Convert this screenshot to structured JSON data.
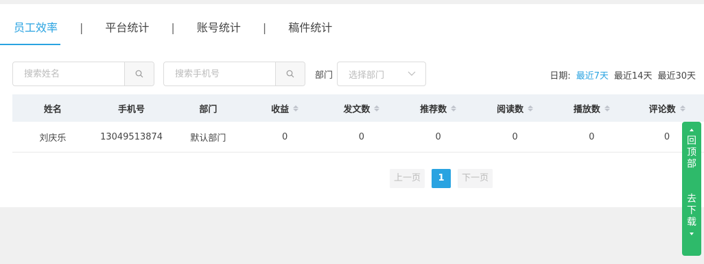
{
  "tabs": [
    {
      "label": "员工效率",
      "active": true
    },
    {
      "label": "平台统计",
      "active": false
    },
    {
      "label": "账号统计",
      "active": false
    },
    {
      "label": "稿件统计",
      "active": false
    }
  ],
  "tab_separator": "|",
  "filters": {
    "name_placeholder": "搜索姓名",
    "phone_placeholder": "搜索手机号",
    "dept_label": "部门",
    "dept_select_placeholder": "选择部门",
    "search_icon": "search-icon"
  },
  "date_filter": {
    "label": "日期:",
    "options": [
      {
        "label": "最近7天",
        "active": true
      },
      {
        "label": "最近14天",
        "active": false
      },
      {
        "label": "最近30天",
        "active": false
      }
    ]
  },
  "table": {
    "columns": [
      "姓名",
      "手机号",
      "部门",
      "收益",
      "发文数",
      "推荐数",
      "阅读数",
      "播放数",
      "评论数"
    ],
    "rows": [
      [
        "刘庆乐",
        "13049513874",
        "默认部门",
        "0",
        "0",
        "0",
        "0",
        "0",
        "0"
      ]
    ]
  },
  "pagination": {
    "prev": "上一页",
    "current": "1",
    "next": "下一页"
  },
  "float_widget": {
    "top_label": [
      "回",
      "顶",
      "部"
    ],
    "bottom_label": [
      "去",
      "下",
      "载"
    ]
  },
  "colors": {
    "accent": "#29a3e1",
    "float_green": "#2eba6a"
  }
}
